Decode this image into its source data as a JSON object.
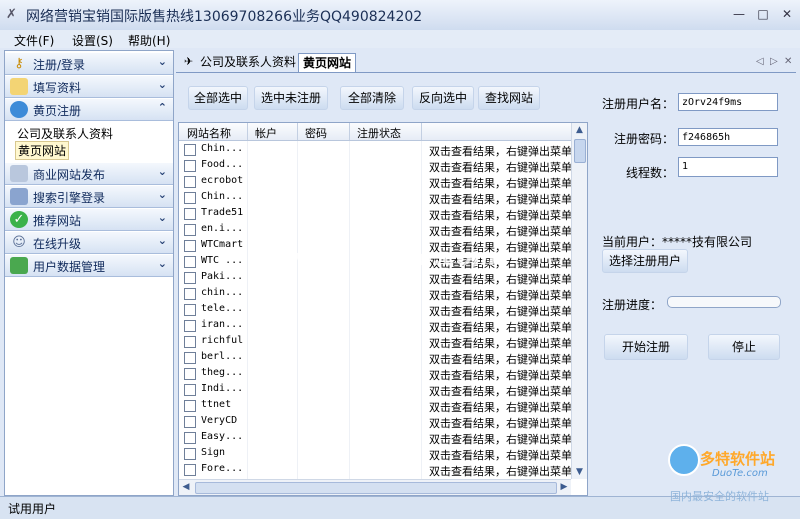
{
  "window": {
    "title": "网络营销宝销国际版售热线13069708266业务QQ490824202"
  },
  "menu": [
    "文件(F)",
    "设置(S)",
    "帮助(H)"
  ],
  "sidebar": {
    "items": [
      {
        "label": "注册/登录",
        "icon": "key-icon"
      },
      {
        "label": "填写资料",
        "icon": "folder-icon"
      },
      {
        "label": "黄页注册",
        "icon": "globe-icon"
      },
      {
        "label": "商业网站发布",
        "icon": "book-icon"
      },
      {
        "label": "搜索引擎登录",
        "icon": "panel-icon"
      },
      {
        "label": "推荐网站",
        "icon": "check-icon"
      },
      {
        "label": "在线升级",
        "icon": "user-icon"
      },
      {
        "label": "用户数据管理",
        "icon": "disk-icon"
      }
    ],
    "subitems": [
      "公司及联系人资料",
      "黄页网站"
    ]
  },
  "tabs": [
    "公司及联系人资料",
    "黄页网站"
  ],
  "toolbar": [
    "全部选中",
    "选中未注册",
    "全部清除",
    "反向选中",
    "查找网站"
  ],
  "grid": {
    "headers": [
      "网站名称",
      "帐户",
      "密码",
      "注册状态"
    ],
    "rows": [
      {
        "name": "Chin...",
        "status": "双击查看结果，右键弹出菜单"
      },
      {
        "name": "Food...",
        "status": "双击查看结果，右键弹出菜单"
      },
      {
        "name": "ecrobot",
        "status": "双击查看结果，右键弹出菜单"
      },
      {
        "name": "Chin...",
        "status": "双击查看结果，右键弹出菜单"
      },
      {
        "name": "Trade51",
        "status": "双击查看结果，右键弹出菜单"
      },
      {
        "name": "en.i...",
        "status": "双击查看结果，右键弹出菜单"
      },
      {
        "name": "WTCmart",
        "status": "双击查看结果，右键弹出菜单"
      },
      {
        "name": "WTC ...",
        "status": "双击查看结果，右键弹出菜单"
      },
      {
        "name": "Paki...",
        "status": "双击查看结果，右键弹出菜单"
      },
      {
        "name": "chin...",
        "status": "双击查看结果，右键弹出菜单"
      },
      {
        "name": "tele...",
        "status": "双击查看结果，右键弹出菜单"
      },
      {
        "name": "iran...",
        "status": "双击查看结果，右键弹出菜单"
      },
      {
        "name": "richful",
        "status": "双击查看结果，右键弹出菜单"
      },
      {
        "name": "berl...",
        "status": "双击查看结果，右键弹出菜单"
      },
      {
        "name": "theg...",
        "status": "双击查看结果，右键弹出菜单"
      },
      {
        "name": "Indi...",
        "status": "双击查看结果，右键弹出菜单"
      },
      {
        "name": "ttnet",
        "status": "双击查看结果，右键弹出菜单"
      },
      {
        "name": "VeryCD",
        "status": "双击查看结果，右键弹出菜单"
      },
      {
        "name": "Easy...",
        "status": "双击查看结果，右键弹出菜单"
      },
      {
        "name": "Sign",
        "status": "双击查看结果，右键弹出菜单"
      },
      {
        "name": "Fore...",
        "status": "双击查看结果，右键弹出菜单"
      }
    ]
  },
  "form": {
    "username_label": "注册用户名：",
    "username_value": "zOrv24f9ms",
    "password_label": "注册密码：",
    "password_value": "f246865h",
    "threads_label": "线程数：",
    "threads_value": "1",
    "current_user": "当前用户：*****技有限公司",
    "select_user_button": "选择注册用户",
    "progress_label": "注册进度：",
    "progress_value": 0,
    "start_button": "开始注册",
    "stop_button": "停止"
  },
  "status": "试用用户",
  "watermark": "www.DuoTe.com",
  "logo": {
    "name": "多特软件站",
    "url": "DuoTe.com",
    "slogan": "国内最安全的软件站"
  }
}
